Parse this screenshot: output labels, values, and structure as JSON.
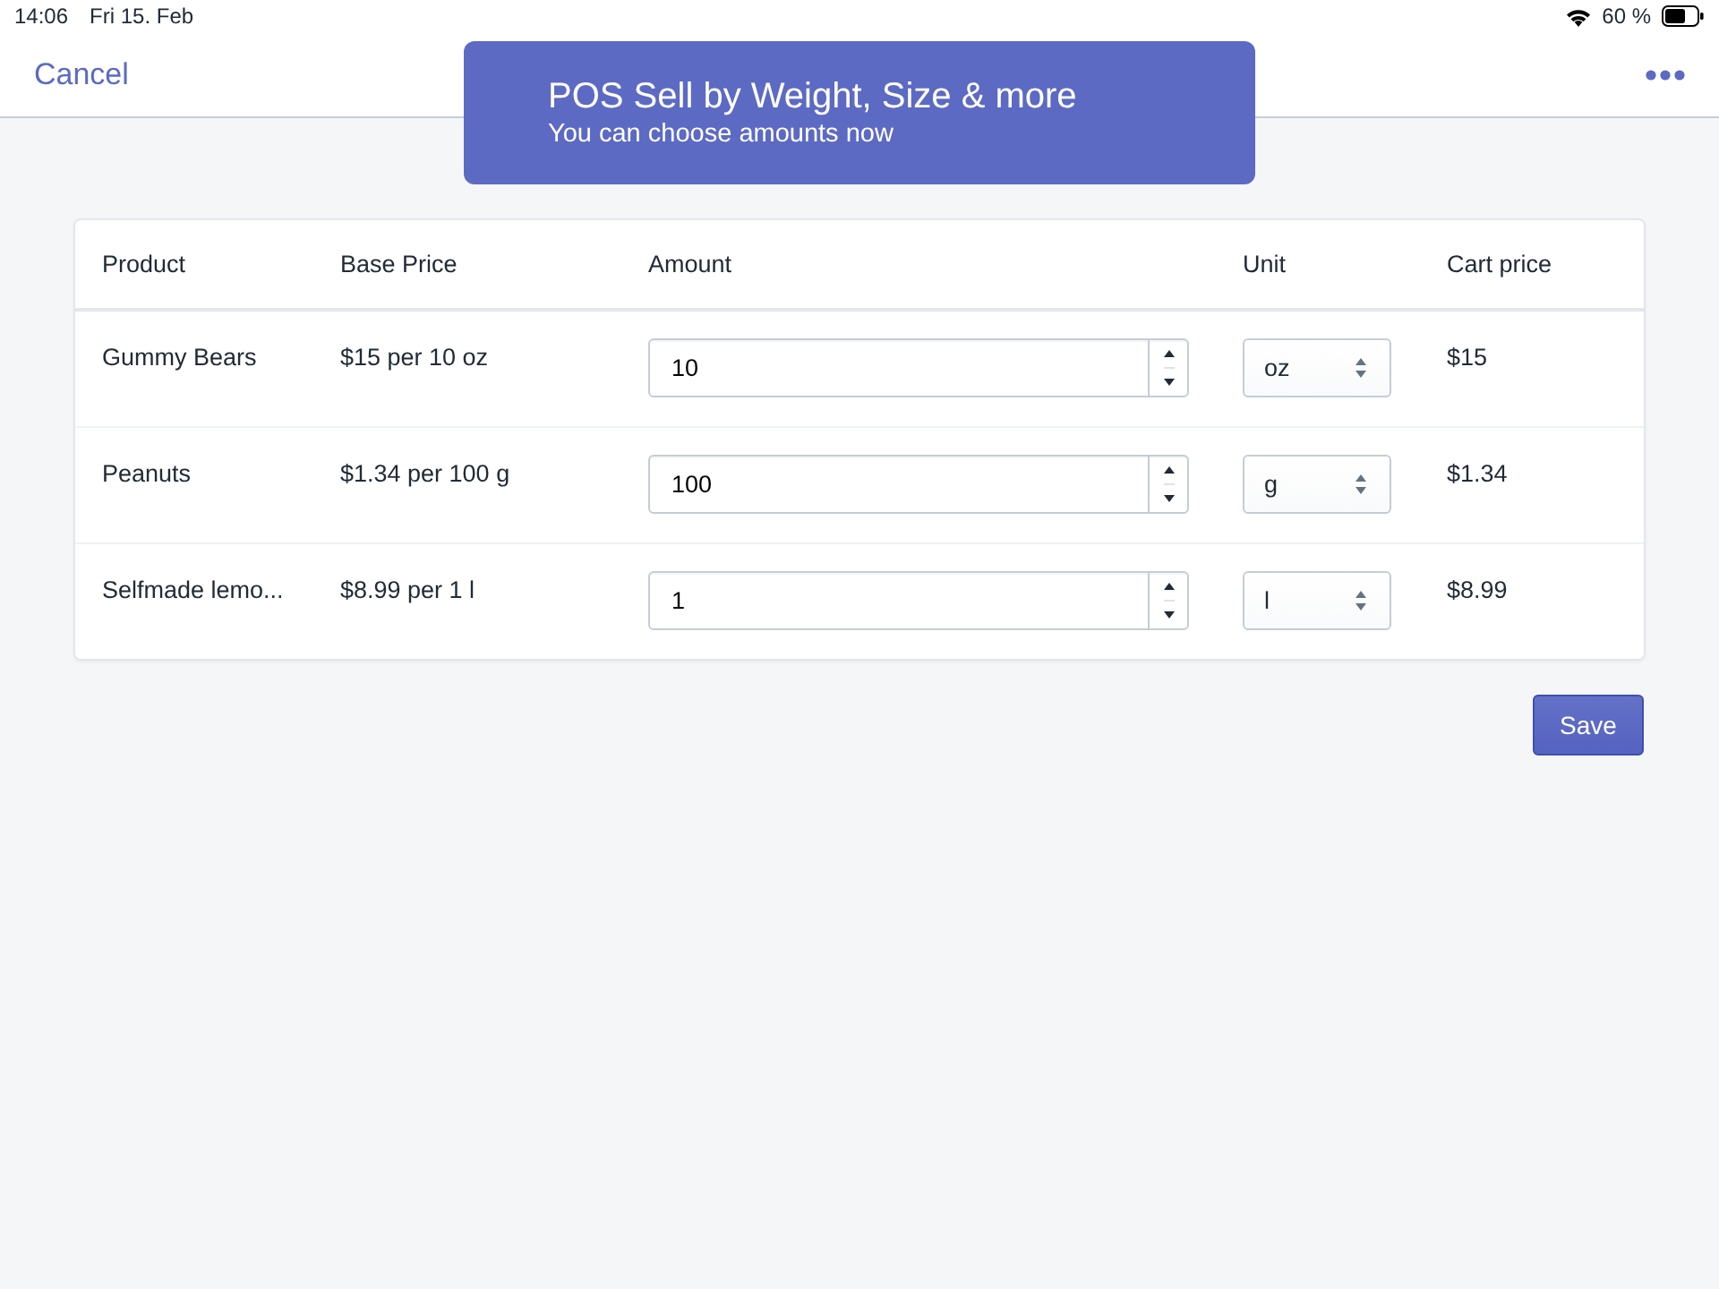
{
  "status_bar": {
    "time": "14:06",
    "date": "Fri 15. Feb",
    "battery": "60 %"
  },
  "nav": {
    "cancel": "Cancel"
  },
  "toast": {
    "title": "POS Sell by Weight, Size & more",
    "subtitle": "You can choose amounts now"
  },
  "table": {
    "columns": [
      "Product",
      "Base Price",
      "Amount",
      "Unit",
      "Cart price"
    ],
    "rows": [
      {
        "product": "Gummy Bears",
        "base_price": "$15 per 10 oz",
        "amount": "10",
        "unit": "oz",
        "cart_price": "$15"
      },
      {
        "product": "Peanuts",
        "base_price": "$1.34 per 100 g",
        "amount": "100",
        "unit": "g",
        "cart_price": "$1.34"
      },
      {
        "product": "Selfmade lemo...",
        "base_price": "$8.99 per 1 l",
        "amount": "1",
        "unit": "l",
        "cart_price": "$8.99"
      }
    ]
  },
  "save_button": "Save"
}
